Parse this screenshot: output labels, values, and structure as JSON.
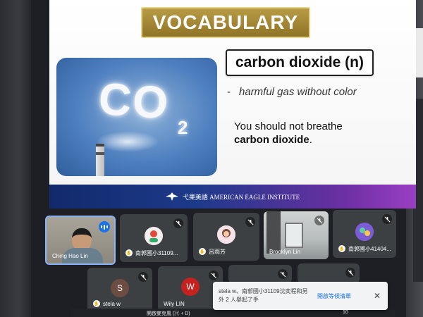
{
  "slide": {
    "banner": "VOCABULARY",
    "word": "carbon dioxide (n)",
    "definition_dash": "-",
    "definition": "harmful gas without color",
    "example_line1": "You should not breathe",
    "example_bold": "carbon dioxide",
    "example_end": ".",
    "image_text_main": "CO",
    "image_text_sub": "2",
    "footer": "弋果美語  AMERICAN EAGLE INSTITUTE"
  },
  "participants": [
    {
      "name": "Ching Hao Lin",
      "speaking": true
    },
    {
      "name": "南郭國小31109...",
      "muted": true
    },
    {
      "name": "呂雨芳",
      "muted": true
    },
    {
      "name": "Brooklyn Lin",
      "muted": true
    },
    {
      "name": "南郭國小41404...",
      "muted": true
    },
    {
      "name": "stela w",
      "initial": "S",
      "color": "#6d4c41",
      "muted": true
    },
    {
      "name": "Wily LIN",
      "initial": "W",
      "color": "#c5221f",
      "muted": true
    }
  ],
  "toast": {
    "message": "stela w、南郭國小31109沈奕程和另外 2 人舉起了手",
    "action": "開啟等候清單",
    "close": "✕"
  },
  "tooltip": "開啟麥克風 (⌘ + D)",
  "counter": "10",
  "colors": {
    "banner_gold": "#b89b45",
    "tile_bg": "#3c4043",
    "active_border": "#8ab4f8",
    "link_blue": "#1a73e8"
  }
}
